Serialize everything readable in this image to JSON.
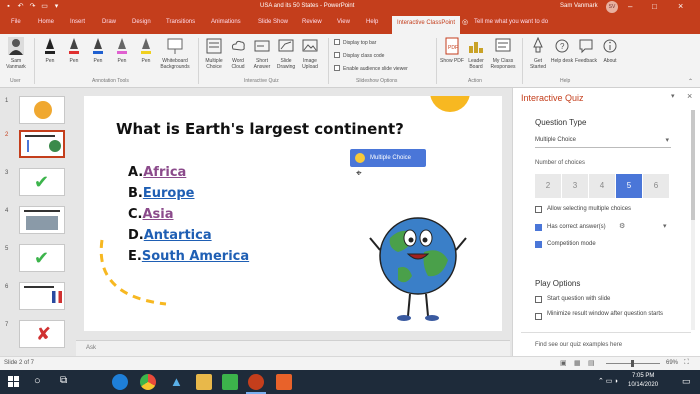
{
  "titlebar": {
    "doc_title": "USA and its 50 States - PowerPoint",
    "user_name": "Sam Vanmark",
    "avatar_initials": "SV"
  },
  "tabs": [
    "File",
    "Home",
    "Insert",
    "Draw",
    "Design",
    "Transitions",
    "Animations",
    "Slide Show",
    "Review",
    "View",
    "Help",
    "Interactive ClassPoint"
  ],
  "tell_me": "Tell me what you want to do",
  "ribbon": {
    "user_button": "Sam Vanmark",
    "pens": [
      "Pen",
      "Pen",
      "Pen",
      "Pen",
      "Pen"
    ],
    "whiteboard": "Whiteboard Backgrounds",
    "quiz_buttons": [
      "Multiple Choice",
      "Word Cloud",
      "Short Answer",
      "Slide Drawing",
      "Image Upload"
    ],
    "checkboxes": [
      "Display top bar",
      "Display class code",
      "Enable audience slide viewer"
    ],
    "action_buttons": [
      "Show PDF",
      "Leader Board",
      "My Class Responses"
    ],
    "help_buttons": [
      "Get Started",
      "Help desk",
      "Feedback",
      "About"
    ],
    "groups": [
      "User",
      "Annotation Tools",
      "Interactive Quiz",
      "Slideshow Options",
      "Action",
      "Help"
    ]
  },
  "thumb_numbers": [
    "1",
    "2",
    "3",
    "4",
    "5",
    "6",
    "7"
  ],
  "slide": {
    "question": "What is Earth's largest continent?",
    "answers": [
      {
        "letter": "A.",
        "text": "Africa"
      },
      {
        "letter": "B.",
        "text": "Europe"
      },
      {
        "letter": "C.",
        "text": "Asia"
      },
      {
        "letter": "D.",
        "text": "Antartica"
      },
      {
        "letter": "E.",
        "text": "South America"
      }
    ],
    "quiz_badge": "Multiple Choice"
  },
  "notes_placeholder": "Ask",
  "pane": {
    "title": "Interactive Quiz",
    "question_type_heading": "Question Type",
    "question_type_value": "Multiple Choice",
    "number_of_choices_label": "Number of choices",
    "choices": [
      "2",
      "3",
      "4",
      "5",
      "6"
    ],
    "selected_choice": "5",
    "options": [
      {
        "label": "Allow selecting multiple choices",
        "checked": false
      },
      {
        "label": "Has correct answer(s)",
        "checked": true
      },
      {
        "label": "Competition mode",
        "checked": true
      }
    ],
    "play_options_heading": "Play Options",
    "play_options": [
      {
        "label": "Start question with slide",
        "checked": false
      },
      {
        "label": "Minimize result window after question starts",
        "checked": false
      }
    ],
    "footer_link": "Find see our quiz examples here"
  },
  "status": {
    "slide_info": "Slide 2 of 7",
    "zoom": "69%"
  },
  "taskbar": {
    "time": "7:05 PM",
    "date": "10/14/2020"
  },
  "colors": {
    "accent": "#c43e1c",
    "link_blue": "#1f5fb4",
    "link_visited": "#8b4a8b",
    "selection_blue": "#4a76d8"
  }
}
